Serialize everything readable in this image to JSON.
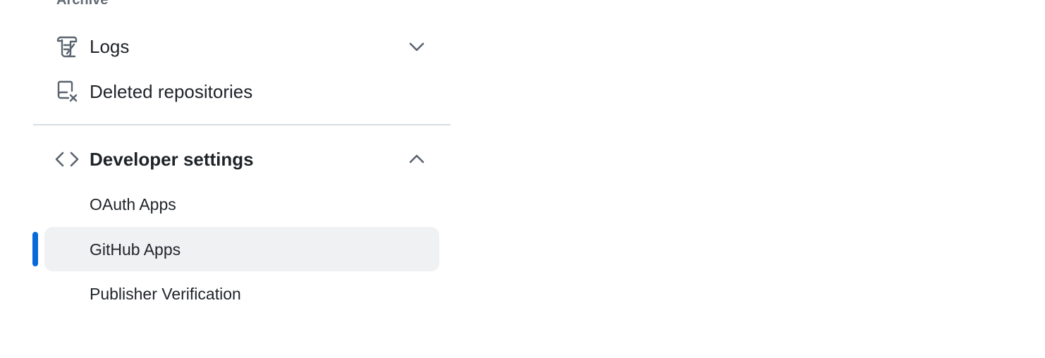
{
  "sidebar": {
    "archive_heading": "Archive",
    "logs": {
      "label": "Logs",
      "icon": "log-icon",
      "expanded": false
    },
    "deleted_repositories": {
      "label": "Deleted repositories",
      "icon": "repo-deleted-icon"
    },
    "developer_settings": {
      "label": "Developer settings",
      "icon": "code-icon",
      "expanded": true,
      "items": [
        {
          "label": "OAuth Apps"
        },
        {
          "label": "GitHub Apps",
          "active": true
        },
        {
          "label": "Publisher Verification"
        }
      ]
    }
  },
  "colors": {
    "accent": "#0969da",
    "active_bg": "#eff1f3",
    "divider": "#d8dee4",
    "text": "#1f2328",
    "muted": "#636c76"
  }
}
